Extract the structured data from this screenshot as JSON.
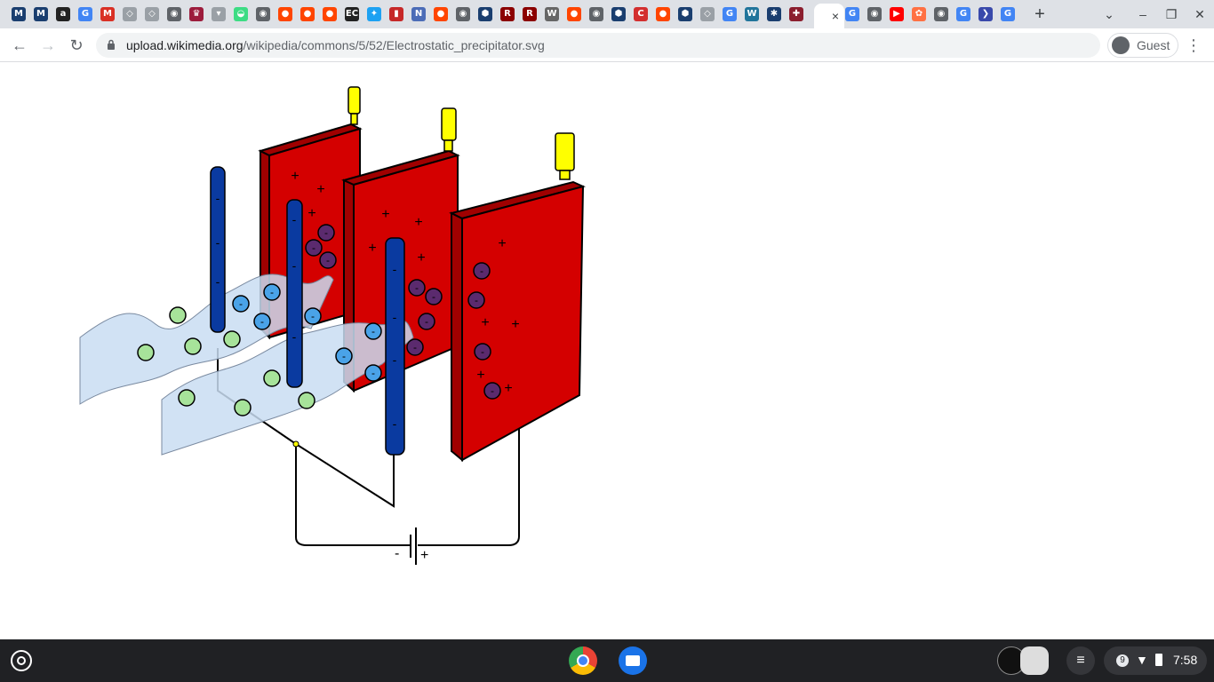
{
  "browser": {
    "tab_favicons": [
      {
        "name": "meridian-tab-1",
        "glyph": "M",
        "color": "#1a3e6f"
      },
      {
        "name": "meridian-tab-2",
        "glyph": "M",
        "color": "#1a3e6f"
      },
      {
        "name": "amazon-tab",
        "glyph": "a",
        "color": "#222222"
      },
      {
        "name": "google-tab-1",
        "glyph": "G",
        "color": "#4285f4"
      },
      {
        "name": "gmail-tab",
        "glyph": "M",
        "color": "#d93025"
      },
      {
        "name": "diamond-tab-1",
        "glyph": "◇",
        "color": "#9aa0a6"
      },
      {
        "name": "diamond-tab-2",
        "glyph": "◇",
        "color": "#9aa0a6"
      },
      {
        "name": "globe-tab-1",
        "glyph": "◉",
        "color": "#5f6368"
      },
      {
        "name": "crest-tab",
        "glyph": "♛",
        "color": "#9c1c3c"
      },
      {
        "name": "arrow-tab",
        "glyph": "▾",
        "color": "#9aa0a6"
      },
      {
        "name": "android-tab",
        "glyph": "◒",
        "color": "#3ddc84"
      },
      {
        "name": "globe-tab-2",
        "glyph": "◉",
        "color": "#5f6368"
      },
      {
        "name": "reddit-tab-1",
        "glyph": "●",
        "color": "#ff4500"
      },
      {
        "name": "reddit-tab-2",
        "glyph": "●",
        "color": "#ff4500"
      },
      {
        "name": "reddit-tab-3",
        "glyph": "●",
        "color": "#ff4500"
      },
      {
        "name": "ec-tab",
        "glyph": "EC",
        "color": "#222222"
      },
      {
        "name": "twitter-tab",
        "glyph": "✦",
        "color": "#1da1f2"
      },
      {
        "name": "chart-tab",
        "glyph": "▮",
        "color": "#c62828"
      },
      {
        "name": "edit-tab",
        "glyph": "N",
        "color": "#4b6cb7"
      },
      {
        "name": "reddit-tab-4",
        "glyph": "●",
        "color": "#ff4500"
      },
      {
        "name": "globe-tab-3",
        "glyph": "◉",
        "color": "#5f6368"
      },
      {
        "name": "shield-tab-1",
        "glyph": "⬢",
        "color": "#1a3e6f"
      },
      {
        "name": "rocks-tab-1",
        "glyph": "R",
        "color": "#8b0000"
      },
      {
        "name": "rocks-tab-2",
        "glyph": "R",
        "color": "#8b0000"
      },
      {
        "name": "wikipedia-tab-1",
        "glyph": "W",
        "color": "#666666"
      },
      {
        "name": "reddit-tab-5",
        "glyph": "●",
        "color": "#ff4500"
      },
      {
        "name": "globe-tab-4",
        "glyph": "◉",
        "color": "#5f6368"
      },
      {
        "name": "shield-tab-2",
        "glyph": "⬢",
        "color": "#1a3e6f"
      },
      {
        "name": "c-tab",
        "glyph": "C",
        "color": "#d32f2f"
      },
      {
        "name": "reddit-tab-6",
        "glyph": "●",
        "color": "#ff4500"
      },
      {
        "name": "shield-tab-3",
        "glyph": "⬢",
        "color": "#1a3e6f"
      },
      {
        "name": "diamond-tab-3",
        "glyph": "◇",
        "color": "#9aa0a6"
      },
      {
        "name": "google-tab-2",
        "glyph": "G",
        "color": "#4285f4"
      },
      {
        "name": "wordpress-tab",
        "glyph": "W",
        "color": "#21759b"
      },
      {
        "name": "network-tab",
        "glyph": "✱",
        "color": "#1a3e6f"
      },
      {
        "name": "university-tab",
        "glyph": "✚",
        "color": "#8b1e2e"
      }
    ],
    "active_tab_close": "×",
    "tabs_after_active": [
      {
        "name": "google-tab-3",
        "glyph": "G",
        "color": "#4285f4"
      },
      {
        "name": "globe-tab-5",
        "glyph": "◉",
        "color": "#5f6368"
      },
      {
        "name": "youtube-tab",
        "glyph": "▶",
        "color": "#ff0000"
      },
      {
        "name": "flower-tab",
        "glyph": "✿",
        "color": "#ff7043"
      },
      {
        "name": "globe-tab-6",
        "glyph": "◉",
        "color": "#5f6368"
      },
      {
        "name": "google-tab-4",
        "glyph": "G",
        "color": "#4285f4"
      },
      {
        "name": "forward-tab",
        "glyph": "❯",
        "color": "#3949ab"
      },
      {
        "name": "google-tab-5",
        "glyph": "G",
        "color": "#4285f4"
      }
    ],
    "new_tab_label": "+",
    "url_host": "upload.wikimedia.org",
    "url_path": "/wikipedia/commons/5/52/Electrostatic_precipitator.svg",
    "profile_label": "Guest"
  },
  "diagram": {
    "battery_minus": "-",
    "battery_plus": "+",
    "wire_minus_sign": "-",
    "plate_plus_sign": "+",
    "colors": {
      "plate": "#d40000",
      "plate_edge": "#a00000",
      "electrode": "#0a3aa0",
      "gas": "#c9ddf2",
      "neutral": "#a7e39a",
      "ion": "#4aa3e8",
      "collected": "#5b2a6e",
      "insulator": "#ffff00"
    }
  },
  "shelf": {
    "clock": "7:58",
    "notification_count": "9"
  }
}
